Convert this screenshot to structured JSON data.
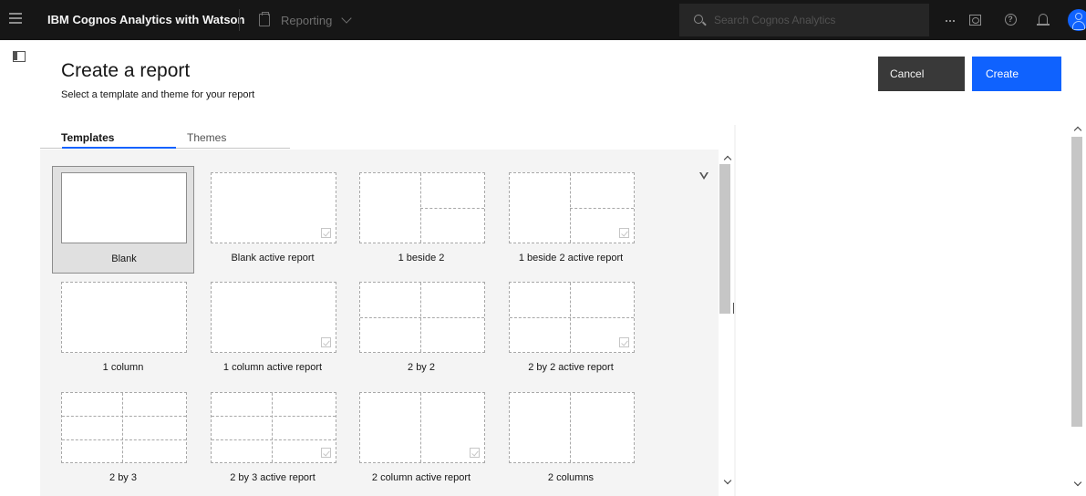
{
  "header": {
    "app_title": "IBM Cognos Analytics with Watson",
    "context_label": "Reporting",
    "search_placeholder": "Search Cognos Analytics",
    "icons": [
      "menu-icon",
      "report-icon",
      "chevron-down-icon",
      "search-icon",
      "overflow-menu-icon",
      "view-icon",
      "help-icon",
      "notification-icon",
      "user-avatar-icon"
    ]
  },
  "page": {
    "title": "Create a report",
    "subtitle": "Select a template and theme for your report",
    "cancel_label": "Cancel",
    "create_label": "Create"
  },
  "tabs": [
    {
      "label": "Templates",
      "selected": true
    },
    {
      "label": "Themes",
      "selected": false
    }
  ],
  "templates": [
    {
      "label": "Blank",
      "selected": true,
      "active_report": false
    },
    {
      "label": "Blank active report",
      "selected": false,
      "active_report": true
    },
    {
      "label": "1 beside 2",
      "selected": false,
      "active_report": false
    },
    {
      "label": "1 beside 2 active report",
      "selected": false,
      "active_report": true
    },
    {
      "label": "1 column",
      "selected": false,
      "active_report": false
    },
    {
      "label": "1 column active report",
      "selected": false,
      "active_report": true
    },
    {
      "label": "2 by 2",
      "selected": false,
      "active_report": false
    },
    {
      "label": "2 by 2 active report",
      "selected": false,
      "active_report": true
    },
    {
      "label": "2 by 3",
      "selected": false,
      "active_report": false
    },
    {
      "label": "2 by 3 active report",
      "selected": false,
      "active_report": true
    },
    {
      "label": "2 column active report",
      "selected": false,
      "active_report": true
    },
    {
      "label": "2 columns",
      "selected": false,
      "active_report": false
    }
  ],
  "colors": {
    "topbar": "#161616",
    "primary": "#0f62fe",
    "secondary": "#393939",
    "panel": "#f4f4f4"
  }
}
